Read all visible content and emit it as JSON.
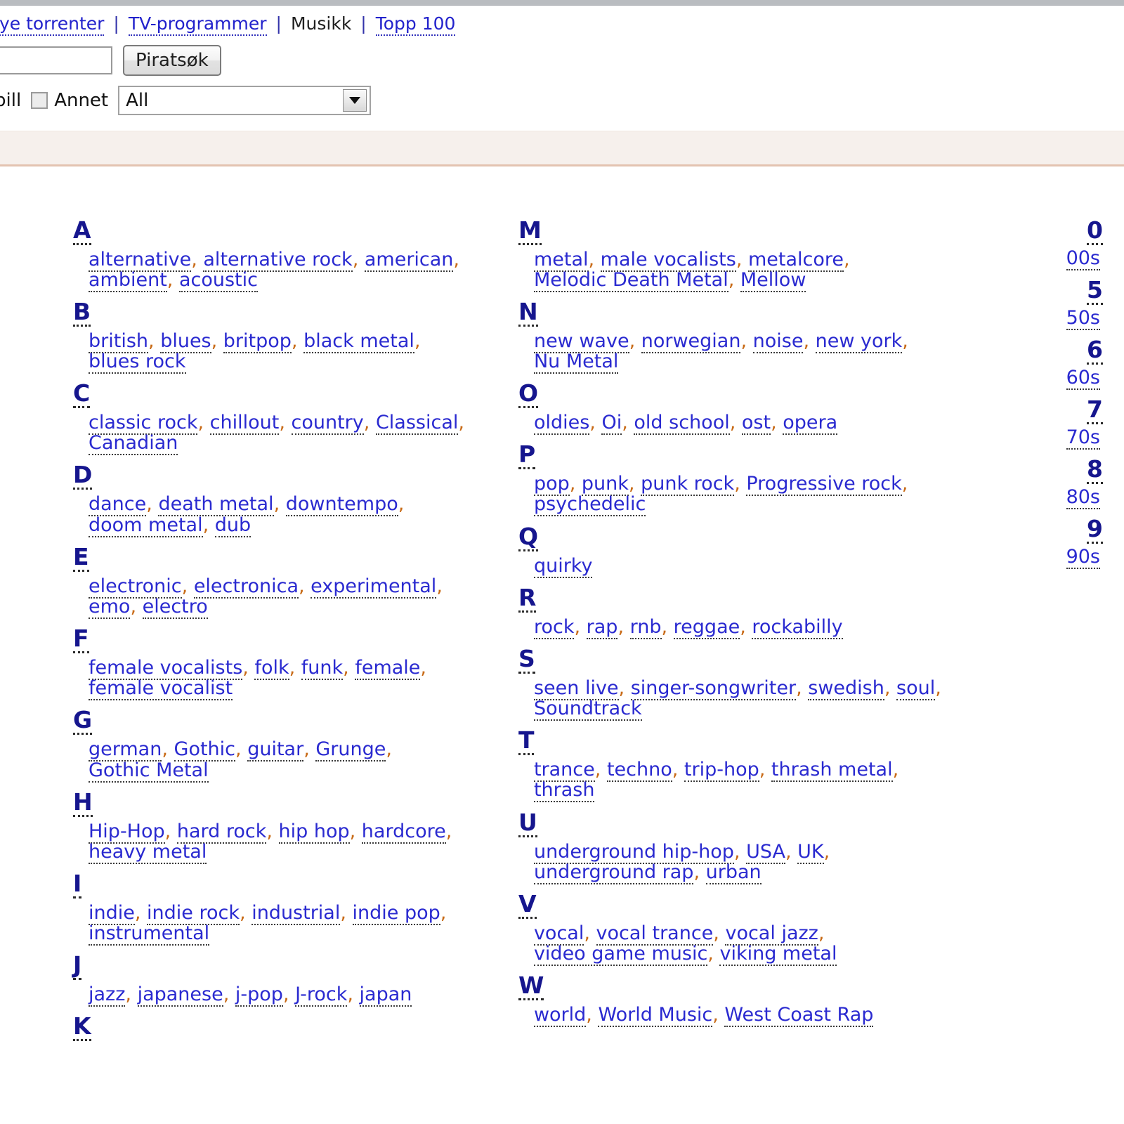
{
  "header": {
    "nav": [
      {
        "label": "Nye torrenter",
        "type": "link",
        "truncated": true,
        "visible_label": "lye torrenter"
      },
      {
        "label": "|",
        "type": "separator"
      },
      {
        "label": "TV-programmer",
        "type": "link"
      },
      {
        "label": "|",
        "type": "separator"
      },
      {
        "label": "Musikk",
        "type": "plain"
      },
      {
        "label": "|",
        "type": "separator"
      },
      {
        "label": "Topp 100",
        "type": "link"
      }
    ],
    "search": {
      "value": "",
      "placeholder": "",
      "button_label": "Piratsøk"
    },
    "filters": {
      "spill_label": "pill",
      "annet_label": "Annet",
      "annet_checked": false,
      "category_value": "All",
      "category_options": [
        "All"
      ]
    }
  },
  "colors": {
    "heading": "#16168e",
    "link": "#2a2ad0",
    "nav_link": "#2222cc",
    "band_bg": "#f6f0ec",
    "band_border": "#e3c3b0",
    "separator": "#c86a16"
  },
  "columns": {
    "left": [
      {
        "letter": "A",
        "tags": [
          "alternative",
          "alternative rock",
          "american",
          "ambient",
          "acoustic"
        ]
      },
      {
        "letter": "B",
        "tags": [
          "british",
          "blues",
          "britpop",
          "black metal",
          "blues rock"
        ]
      },
      {
        "letter": "C",
        "tags": [
          "classic rock",
          "chillout",
          "country",
          "Classical",
          "Canadian"
        ]
      },
      {
        "letter": "D",
        "tags": [
          "dance",
          "death metal",
          "downtempo",
          "doom metal",
          "dub"
        ]
      },
      {
        "letter": "E",
        "tags": [
          "electronic",
          "electronica",
          "experimental",
          "emo",
          "electro"
        ]
      },
      {
        "letter": "F",
        "tags": [
          "female vocalists",
          "folk",
          "funk",
          "female",
          "female vocalist"
        ]
      },
      {
        "letter": "G",
        "tags": [
          "german",
          "Gothic",
          "guitar",
          "Grunge",
          "Gothic Metal"
        ]
      },
      {
        "letter": "H",
        "tags": [
          "Hip-Hop",
          "hard rock",
          "hip hop",
          "hardcore",
          "heavy metal"
        ]
      },
      {
        "letter": "I",
        "tags": [
          "indie",
          "indie rock",
          "industrial",
          "indie pop",
          "instrumental"
        ]
      },
      {
        "letter": "J",
        "tags": [
          "jazz",
          "japanese",
          "j-pop",
          "J-rock",
          "japan"
        ]
      },
      {
        "letter": "K",
        "tags": []
      }
    ],
    "mid": [
      {
        "letter": "M",
        "tags": [
          "metal",
          "male vocalists",
          "metalcore",
          "Melodic Death Metal",
          "Mellow"
        ]
      },
      {
        "letter": "N",
        "tags": [
          "new wave",
          "norwegian",
          "noise",
          "new york",
          "Nu Metal"
        ]
      },
      {
        "letter": "O",
        "tags": [
          "oldies",
          "Oi",
          "old school",
          "ost",
          "opera"
        ]
      },
      {
        "letter": "P",
        "tags": [
          "pop",
          "punk",
          "punk rock",
          "Progressive rock",
          "psychedelic"
        ]
      },
      {
        "letter": "Q",
        "tags": [
          "quirky"
        ]
      },
      {
        "letter": "R",
        "tags": [
          "rock",
          "rap",
          "rnb",
          "reggae",
          "rockabilly"
        ]
      },
      {
        "letter": "S",
        "tags": [
          "seen live",
          "singer-songwriter",
          "swedish",
          "soul",
          "Soundtrack"
        ]
      },
      {
        "letter": "T",
        "tags": [
          "trance",
          "techno",
          "trip-hop",
          "thrash metal",
          "thrash"
        ]
      },
      {
        "letter": "U",
        "tags": [
          "underground hip-hop",
          "USA",
          "UK",
          "underground rap",
          "urban"
        ]
      },
      {
        "letter": "V",
        "tags": [
          "vocal",
          "vocal trance",
          "vocal jazz",
          "video game music",
          "viking metal"
        ]
      },
      {
        "letter": "W",
        "tags": [
          "world",
          "World Music",
          "West Coast Rap"
        ]
      }
    ],
    "right": [
      {
        "letter": "0",
        "tags": [
          "00s"
        ]
      },
      {
        "letter": "5",
        "tags": [
          "50s"
        ]
      },
      {
        "letter": "6",
        "tags": [
          "60s"
        ]
      },
      {
        "letter": "7",
        "tags": [
          "70s"
        ]
      },
      {
        "letter": "8",
        "tags": [
          "80s"
        ]
      },
      {
        "letter": "9",
        "tags": [
          "90s"
        ]
      }
    ]
  }
}
